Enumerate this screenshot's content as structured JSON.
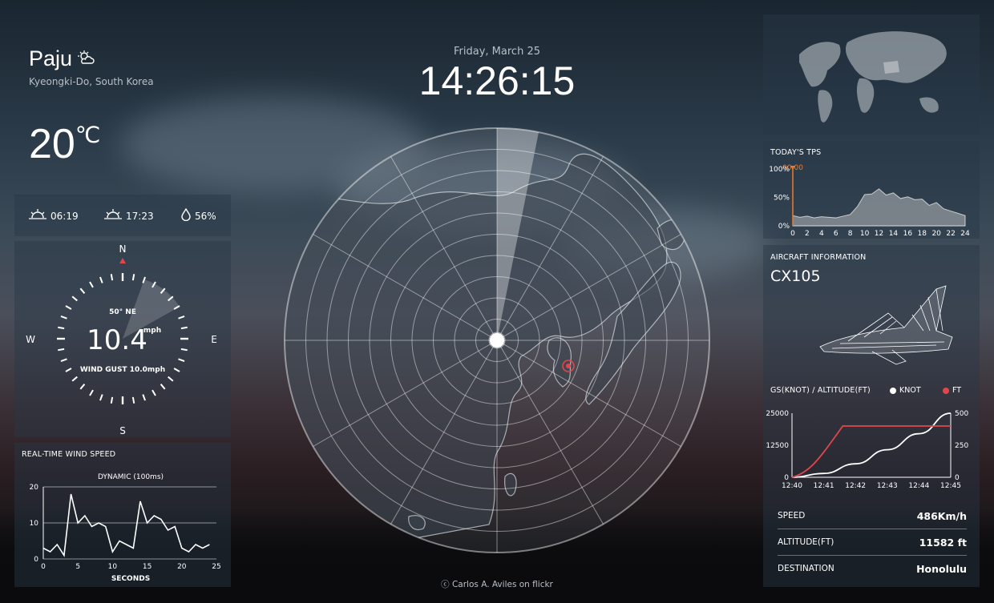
{
  "location": {
    "city": "Paju",
    "region": "Kyeongki-Do, South Korea",
    "weather_icon": "partly-cloudy-icon",
    "temperature": "20",
    "temperature_unit": "℃"
  },
  "sun": {
    "sunrise": "06:19",
    "sunset": "17:23",
    "humidity": "56%"
  },
  "wind": {
    "direction_label": "50° NE",
    "speed": "10.4",
    "unit": "mph",
    "gust": "WIND GUST 10.0mph",
    "compass": {
      "n": "N",
      "s": "S",
      "e": "E",
      "w": "W"
    }
  },
  "wind_chart": {
    "title": "REAL-TIME WIND SPEED",
    "subtitle": "DYNAMIC (100ms)",
    "chart_data": {
      "type": "line",
      "x": [
        0,
        1,
        2,
        3,
        4,
        5,
        6,
        7,
        8,
        9,
        10,
        11,
        12,
        13,
        14,
        15,
        16,
        17,
        18,
        19,
        20,
        21,
        22,
        23,
        24
      ],
      "values": [
        3,
        2,
        4,
        1,
        18,
        10,
        12,
        9,
        10,
        9,
        2,
        5,
        4,
        3,
        16,
        10,
        12,
        11,
        8,
        9,
        3,
        2,
        4,
        3,
        4
      ],
      "xlabel": "SECONDS",
      "xticks": [
        "0",
        "5",
        "10",
        "15",
        "20",
        "25"
      ],
      "yticks": [
        "0",
        "10",
        "20"
      ],
      "ylim": [
        0,
        20
      ],
      "xlim": [
        0,
        25
      ]
    }
  },
  "clock": {
    "date": "Friday, March 25",
    "time": "14:26:15"
  },
  "credit": "ⓒ Carlos A. Aviles on flickr",
  "tps": {
    "title": "TODAY'S TPS",
    "marker_label": "00:00",
    "chart_data": {
      "type": "area",
      "xticks": [
        "0",
        "2",
        "4",
        "6",
        "8",
        "10",
        "12",
        "14",
        "16",
        "18",
        "20",
        "22",
        "24"
      ],
      "yticks": [
        "100%",
        "50%",
        "0%"
      ],
      "x": [
        0,
        1,
        2,
        3,
        4,
        5,
        6,
        7,
        8,
        9,
        10,
        11,
        12,
        13,
        14,
        15,
        16,
        17,
        18,
        19,
        20,
        21,
        22,
        23,
        24
      ],
      "values": [
        18,
        15,
        17,
        14,
        16,
        15,
        14,
        17,
        20,
        38,
        52,
        60,
        62,
        58,
        55,
        52,
        48,
        50,
        44,
        40,
        38,
        30,
        26,
        22,
        18
      ],
      "ylim": [
        0,
        100
      ],
      "xlim": [
        0,
        24
      ]
    }
  },
  "aircraft": {
    "section_title": "AIRCRAFT INFORMATION",
    "flight": "CX105",
    "chart_title": "GS(KNOT) / ALTITUDE(FT)",
    "legend_knot": "KNOT",
    "legend_ft": "FT",
    "chart_data": {
      "type": "line",
      "categories": [
        "12:40",
        "12:41",
        "12:42",
        "12:43",
        "12:44",
        "12:45"
      ],
      "left_ticks": [
        "25000",
        "12500",
        "0"
      ],
      "right_ticks": [
        "500",
        "250",
        "0"
      ],
      "series": [
        {
          "name": "KNOT",
          "color": "#ffffff",
          "values": [
            0,
            30,
            105,
            215,
            340,
            500
          ]
        },
        {
          "name": "FT",
          "color": "#e0474c",
          "values": [
            0,
            8000,
            20000,
            20000,
            20000,
            20000
          ]
        }
      ]
    },
    "rows": [
      {
        "label": "SPEED",
        "value": "486Km/h"
      },
      {
        "label": "ALTITUDE(FT)",
        "value": "11582 ft"
      },
      {
        "label": "DESTINATION",
        "value": "Honolulu"
      }
    ]
  },
  "colors": {
    "accent_red": "#e0474c",
    "tps_orange": "#f07a2a",
    "panel": "rgba(40,55,70,.45)"
  }
}
